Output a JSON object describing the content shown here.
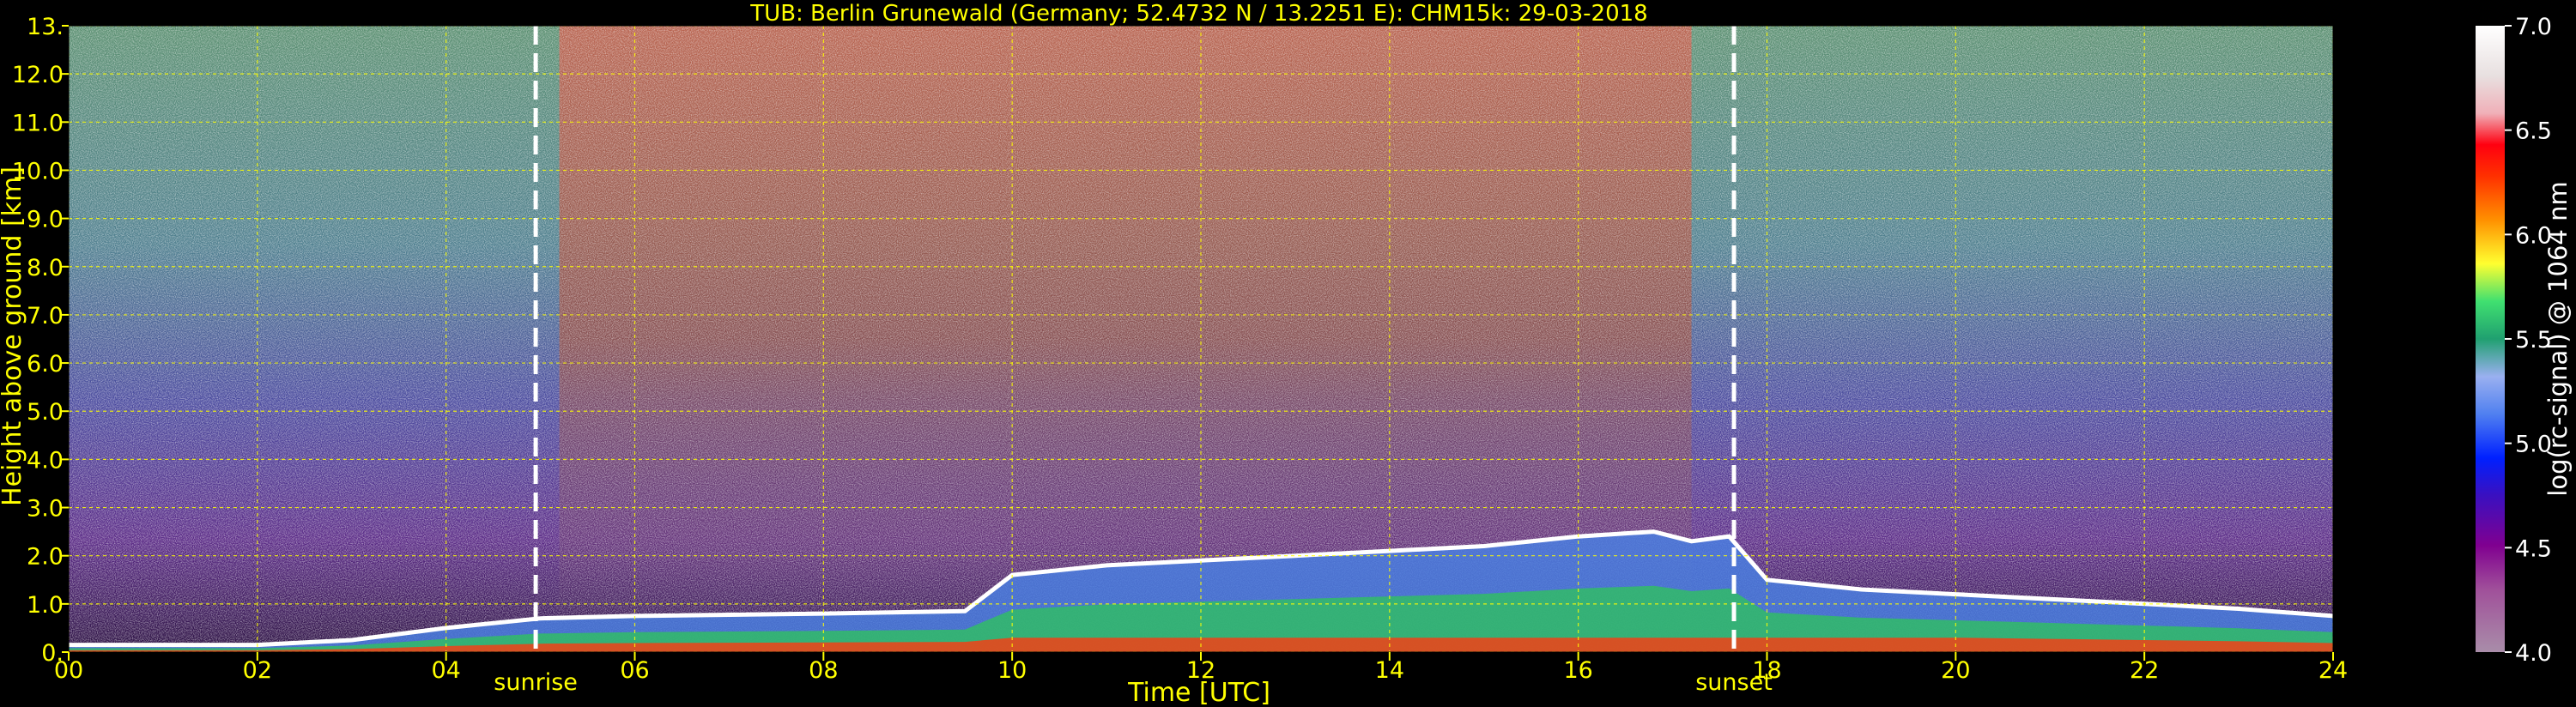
{
  "chart_data": {
    "type": "heatmap",
    "title": "TUB: Berlin Grunewald (Germany; 52.4732 N / 13.2251 E):    CHM15k: 29-03-2018",
    "xlabel": "Time [UTC]",
    "ylabel": "Height above ground [km]",
    "x_ticks": [
      "00",
      "02",
      "04",
      "06",
      "08",
      "10",
      "12",
      "14",
      "16",
      "18",
      "20",
      "22",
      "24"
    ],
    "xlim": [
      0,
      24
    ],
    "y_ticks": [
      "0.",
      "1.0",
      "2.0",
      "3.0",
      "4.0",
      "5.0",
      "6.0",
      "7.0",
      "8.0",
      "9.0",
      "10.0",
      "11.0",
      "12.0",
      "13."
    ],
    "ylim": [
      0,
      13
    ],
    "grid": true,
    "events": [
      {
        "label": "sunrise",
        "time": 4.95
      },
      {
        "label": "sunset",
        "time": 17.65
      }
    ],
    "colorbar": {
      "label": "log(rc-signal) @ 1064 nm",
      "ticks": [
        "4.0",
        "4.5",
        "5.0",
        "5.5",
        "6.0",
        "6.5",
        "7.0"
      ],
      "range": [
        4.0,
        7.0
      ]
    },
    "layers": [
      {
        "name": "boundary-layer top",
        "x": [
          0,
          2,
          3,
          4,
          5,
          6,
          8,
          9.5,
          10,
          11,
          12,
          13,
          14,
          15,
          16,
          16.8,
          17.2,
          17.6,
          18,
          19,
          20,
          21,
          22,
          23,
          24
        ],
        "y": [
          0.15,
          0.15,
          0.25,
          0.5,
          0.7,
          0.75,
          0.8,
          0.85,
          1.6,
          1.8,
          1.9,
          2.0,
          2.1,
          2.2,
          2.4,
          2.5,
          2.3,
          2.4,
          1.5,
          1.3,
          1.2,
          1.1,
          1.0,
          0.9,
          0.75
        ]
      }
    ]
  }
}
